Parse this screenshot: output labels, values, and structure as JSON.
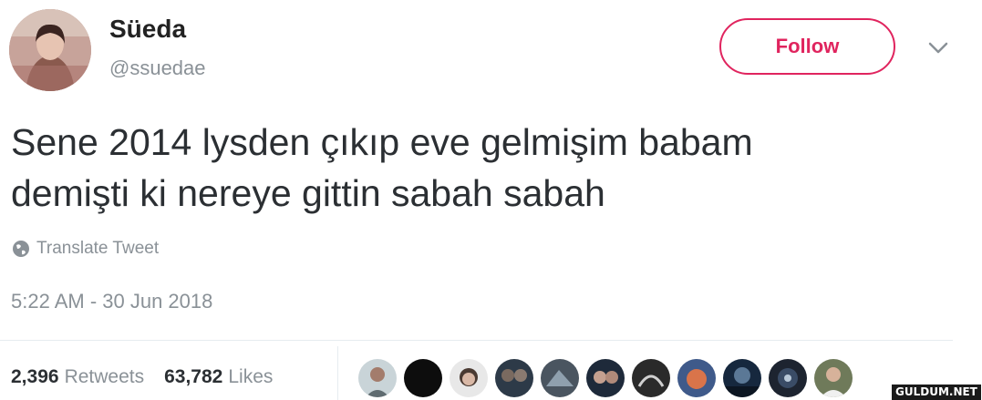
{
  "user": {
    "name": "Süeda",
    "handle": "@ssuedae"
  },
  "header": {
    "follow_label": "Follow",
    "menu_icon": "chevron-down-icon"
  },
  "tweet": {
    "lines": [
      "Sene 2014 lysden çıkıp eve gelmişim babam",
      "demişti ki nereye gittin sabah sabah"
    ],
    "translate_label": "Translate Tweet",
    "timestamp": "5:22 AM - 30 Jun 2018"
  },
  "stats": {
    "retweets_count": "2,396",
    "retweets_label": "Retweets",
    "likes_count": "63,782",
    "likes_label": "Likes"
  },
  "likers": [
    "liker-1",
    "liker-2",
    "liker-3",
    "liker-4",
    "liker-5",
    "liker-6",
    "liker-7",
    "liker-8",
    "liker-9",
    "liker-10",
    "liker-11"
  ],
  "watermark": "GULDUM.NET",
  "colors": {
    "accent": "#e0245e",
    "muted": "#8a9197",
    "text": "#2b2f33"
  }
}
